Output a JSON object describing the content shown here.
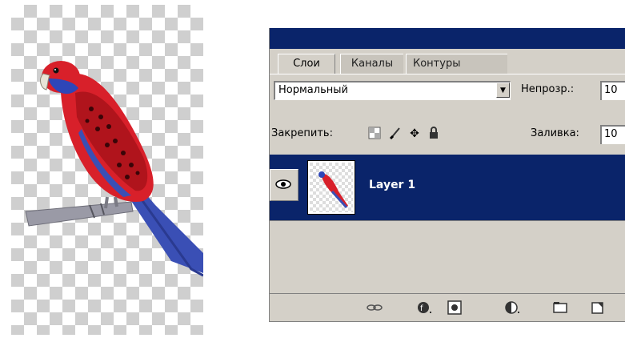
{
  "layers_panel": {
    "tabs": [
      "Слои",
      "Каналы",
      "Контуры"
    ],
    "blend_mode": "Нормальный",
    "opacity_label": "Непрозр.:",
    "opacity_value": "10",
    "lock_label": "Закрепить:",
    "fill_label": "Заливка:",
    "fill_value": "10",
    "layer_name": "Layer 1",
    "lock_icons": [
      "lock-transparent-icon",
      "lock-brush-icon",
      "lock-move-icon",
      "lock-all-icon"
    ],
    "bottom_icons": [
      "link-layers-icon",
      "layer-style-icon",
      "layer-mask-icon",
      "adjustment-layer-icon",
      "new-group-icon",
      "new-layer-icon"
    ],
    "colors": {
      "selection": "#0a246a",
      "panel": "#d4d0c8"
    }
  }
}
